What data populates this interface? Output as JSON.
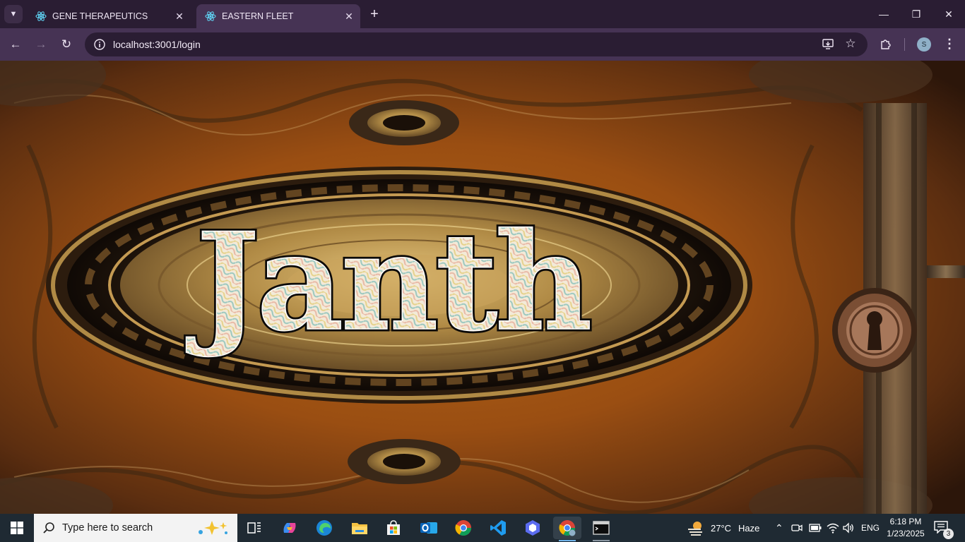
{
  "browser": {
    "tabs": [
      {
        "title": "GENE THERAPEUTICS",
        "active": false
      },
      {
        "title": "EASTERN FLEET",
        "active": true
      }
    ],
    "address": "localhost:3001/login",
    "profile_initial": "S",
    "accent": "#463354"
  },
  "page": {
    "logo_text": "Janth",
    "scene": "ornate steampunk vault door with keyhole"
  },
  "taskbar": {
    "search_placeholder": "Type here to search",
    "weather_temp": "27°C",
    "weather_condition": "Haze",
    "language": "ENG",
    "time": "6:18 PM",
    "date": "1/23/2025",
    "notification_count": "3",
    "pinned_apps": [
      "task-view",
      "copilot",
      "edge",
      "file-explorer",
      "microsoft-store",
      "outlook",
      "chrome",
      "vscode",
      "teams-like-app",
      "chrome-profile",
      "terminal"
    ]
  }
}
